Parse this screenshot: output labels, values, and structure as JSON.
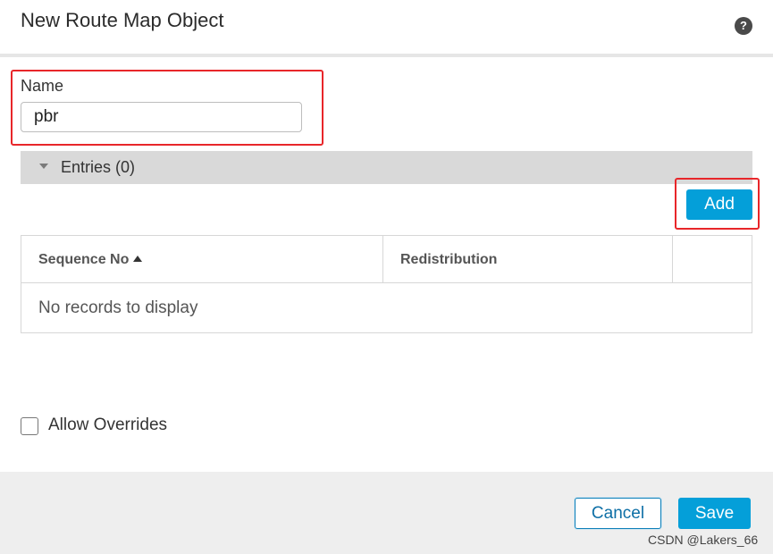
{
  "dialog": {
    "title": "New Route Map Object",
    "help_icon": "question-circle-icon",
    "help_glyph": "?"
  },
  "name_field": {
    "label": "Name",
    "value": "pbr"
  },
  "entries": {
    "label": "Entries (0)",
    "collapse_icon": "caret-down-icon",
    "add_label": "Add"
  },
  "table": {
    "columns": [
      "Sequence No",
      "Redistribution",
      ""
    ],
    "sort_column": "Sequence No",
    "sort_direction": "ascending",
    "empty_message": "No records to display"
  },
  "allow_overrides": {
    "label": "Allow Overrides",
    "checked": false
  },
  "footer": {
    "cancel_label": "Cancel",
    "save_label": "Save"
  },
  "watermark": "CSDN @Lakers_66",
  "colors": {
    "primary": "#049fd9",
    "highlight": "#e8262a",
    "entries_bar": "#d9d9d9",
    "footer_bg": "#eeeeee"
  }
}
